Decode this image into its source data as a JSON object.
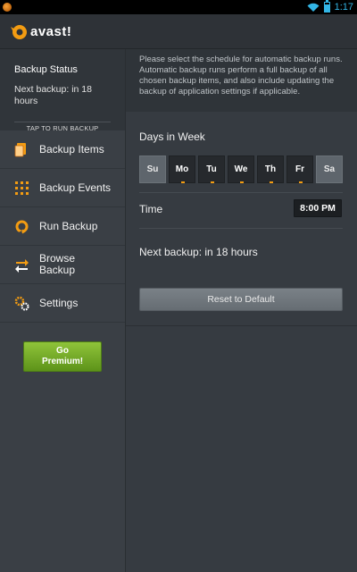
{
  "statusbar": {
    "time": "1:17",
    "icons": [
      "app-notification-icon",
      "wifi-icon",
      "battery-icon"
    ]
  },
  "app": {
    "logo_text": "avast!",
    "accent": "#f39c12",
    "premium_color": "#7cb82f"
  },
  "sidebar": {
    "status_title": "Backup Status",
    "next_backup": "Next backup: in 18 hours",
    "tap_to_run": "TAP TO RUN BACKUP",
    "items": [
      {
        "label": "Backup Items",
        "icon": "backup-items-icon"
      },
      {
        "label": "Backup Events",
        "icon": "grid-icon"
      },
      {
        "label": "Run Backup",
        "icon": "refresh-icon"
      },
      {
        "label": "Browse Backup",
        "icon": "transfer-arrows-icon"
      },
      {
        "label": "Settings",
        "icon": "gear-icon"
      }
    ],
    "premium_label": "Go Premium!"
  },
  "main": {
    "description": "Please select the schedule for automatic backup runs. Automatic backup runs perform a full backup of all chosen backup items, and also include updating the backup of application settings if applicable.",
    "days_title": "Days in Week",
    "days": [
      {
        "label": "Su",
        "selected": false
      },
      {
        "label": "Mo",
        "selected": true
      },
      {
        "label": "Tu",
        "selected": true
      },
      {
        "label": "We",
        "selected": true
      },
      {
        "label": "Th",
        "selected": true
      },
      {
        "label": "Fr",
        "selected": true
      },
      {
        "label": "Sa",
        "selected": false
      }
    ],
    "time_label": "Time",
    "time_value": "8:00 PM",
    "next_backup": "Next backup: in 18 hours",
    "reset_label": "Reset to Default"
  }
}
